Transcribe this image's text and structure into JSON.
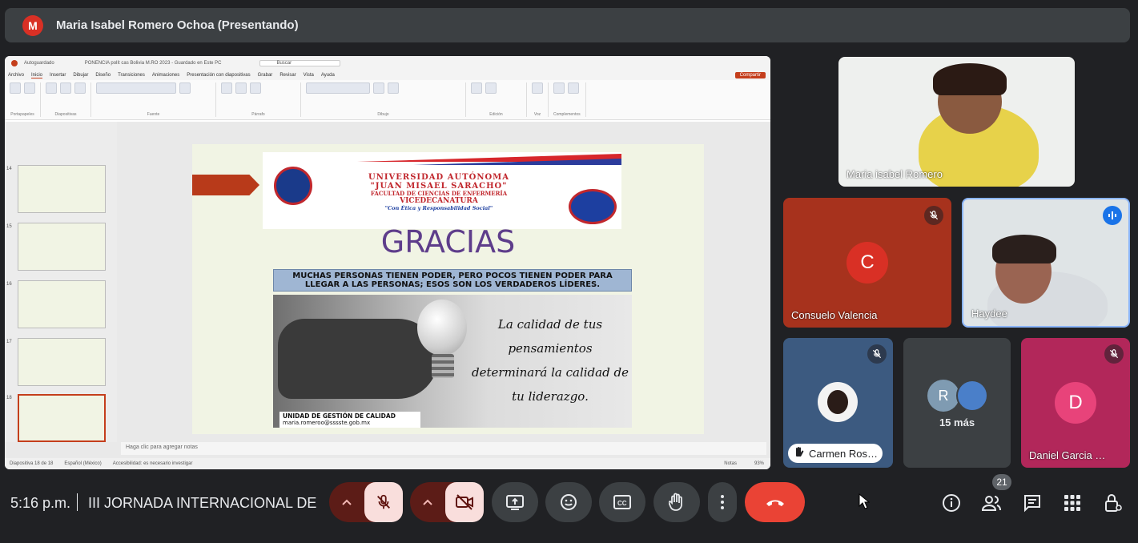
{
  "presenter": {
    "initial": "M",
    "label": "Maria Isabel Romero Ochoa (Presentando)"
  },
  "powerpoint": {
    "autosave": "Autoguardado",
    "file_title": "PONENCIA polít cas Bolivia M.RO 2023 - Guardado en Este PC",
    "search": "Buscar",
    "menu": [
      "Archivo",
      "Inicio",
      "Insertar",
      "Dibujar",
      "Diseño",
      "Transiciones",
      "Animaciones",
      "Presentación con diapositivas",
      "Grabar",
      "Revisar",
      "Vista",
      "Ayuda"
    ],
    "share": "Compartir",
    "ribbon_groups": [
      "Portapapeles",
      "Diapositivas",
      "Fuente",
      "Párrafo",
      "Dibujo",
      "Edición",
      "Voz",
      "Complementos"
    ],
    "thumb_numbers": [
      "14",
      "15",
      "16",
      "17",
      "18"
    ],
    "notes_placeholder": "Haga clic para agregar notas",
    "status_slide": "Diapositiva 18 de 18",
    "status_lang": "Español (México)",
    "status_access": "Accesibilidad: es necesario investigar",
    "status_notes": "Notas",
    "zoom": "93%"
  },
  "slide": {
    "uni_name_1": "UNIVERSIDAD AUTÓNOMA",
    "uni_name_2": "\"JUAN MISAEL SARACHO\"",
    "faculty": "FACULTAD DE CIENCIAS DE ENFERMERÍA",
    "vice": "VICEDECANATURA",
    "slogan": "\"Con Ética y Responsabilidad Social\"",
    "title": "GRACIAS",
    "quote": "MUCHAS PERSONAS TIENEN PODER, PERO POCOS TIENEN PODER PARA LLEGAR A LAS PERSONAS; ESOS SON LOS VERDADEROS LÍDERES.",
    "hand_quote": "La calidad de tus pensamientos determinará la calidad de tu liderazgo.",
    "footer_title": "UNIDAD DE GESTIÓN DE CALIDAD",
    "footer_email": "maria.romeroo@sssste.gob.mx"
  },
  "participants": {
    "maria": "Maria isabel Romero",
    "consuelo_initial": "C",
    "consuelo": "Consuelo Valencia",
    "haydee": "Haydee",
    "carmen": "Carmen Ros…",
    "more_initial": "R",
    "more": "15 más",
    "daniel_initial": "D",
    "daniel": "Daniel Garcia …"
  },
  "bottom": {
    "time": "5:16 p.m.",
    "meeting_title": "III JORNADA INTERNACIONAL DE …",
    "people_count": "21"
  },
  "colors": {
    "bg": "#202124",
    "consuelo_tile": "#a7321d",
    "consuelo_avatar": "#d93025",
    "daniel_tile": "#b2275a",
    "daniel_avatar": "#e8437a",
    "hangup": "#ea4335"
  },
  "icons": [
    "mic-off-icon",
    "speaking-icon",
    "chevron-up-icon",
    "camera-off-icon",
    "present-icon",
    "emoji-icon",
    "captions-icon",
    "raise-hand-icon",
    "more-vert-icon",
    "hangup-icon",
    "info-icon",
    "people-icon",
    "chat-icon",
    "activities-icon",
    "host-controls-icon"
  ]
}
